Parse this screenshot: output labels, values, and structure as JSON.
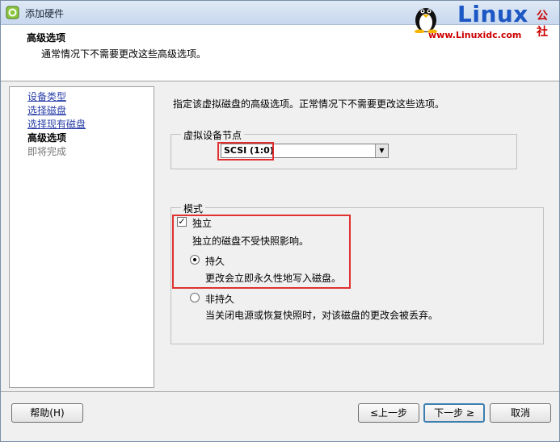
{
  "window": {
    "title": "添加硬件"
  },
  "watermark": {
    "logo_text": "Linux",
    "logo_suffix": "公社",
    "url": "www.Linuxidc.com"
  },
  "header": {
    "title": "高级选项",
    "subtitle": "通常情况下不需要更改这些高级选项。"
  },
  "steps": [
    {
      "label": "设备类型",
      "state": "link"
    },
    {
      "label": "选择磁盘",
      "state": "link"
    },
    {
      "label": "选择现有磁盘",
      "state": "link"
    },
    {
      "label": "高级选项",
      "state": "current"
    },
    {
      "label": "即将完成",
      "state": "pending"
    }
  ],
  "main": {
    "description": "指定该虚拟磁盘的高级选项。正常情况下不需要更改这些选项。",
    "virtual_device_node": {
      "group_label": "虚拟设备节点",
      "selected": "SCSI (1:0)"
    },
    "mode": {
      "group_label": "模式",
      "independent": {
        "label": "独立",
        "checked": true,
        "description": "独立的磁盘不受快照影响。"
      },
      "persistent": {
        "label": "持久",
        "selected": true,
        "description": "更改会立即永久性地写入磁盘。"
      },
      "nonpersistent": {
        "label": "非持久",
        "selected": false,
        "description": "当关闭电源或恢复快照时，对该磁盘的更改会被丢弃。"
      }
    }
  },
  "buttons": {
    "help": "帮助(H)",
    "back": "≤上一步",
    "next": "下一步 ≥",
    "cancel": "取消"
  },
  "colors": {
    "highlight": "#e03030",
    "link": "#2a3fa8",
    "watermark_blue": "#1c57c4",
    "watermark_red": "#cc0000"
  }
}
